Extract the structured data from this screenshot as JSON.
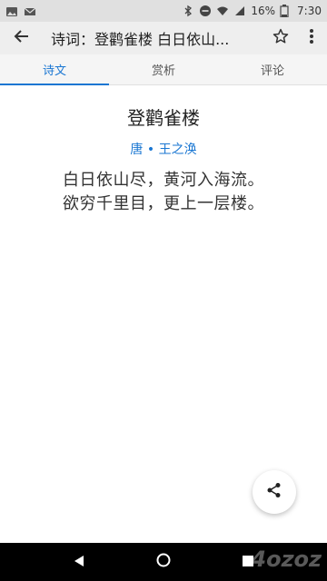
{
  "status_bar": {
    "battery_text": "16%",
    "time": "7:30",
    "icons": [
      "image-icon",
      "gmail-icon",
      "bluetooth-icon",
      "dnd-icon",
      "wifi-icon",
      "signal-icon",
      "battery-icon"
    ]
  },
  "app_bar": {
    "title": "诗词：登鹳雀楼 白日依山...",
    "icons": [
      "back-arrow-icon",
      "star-outline-icon",
      "more-vert-icon"
    ]
  },
  "tabs": [
    {
      "label": "诗文",
      "active": true
    },
    {
      "label": "赏析",
      "active": false
    },
    {
      "label": "评论",
      "active": false
    }
  ],
  "poem": {
    "title": "登鹳雀楼",
    "meta": "唐 • 王之涣",
    "lines": [
      "白日依山尽，黄河入海流。",
      "欲穷千里目，更上一层楼。"
    ]
  },
  "fab": {
    "icon": "share-icon"
  },
  "nav_bar": {
    "icons": [
      "back-triangle-icon",
      "home-circle-icon",
      "recents-square-icon"
    ]
  },
  "watermark": {
    "text": "4ozoz"
  },
  "colors": {
    "accent": "#1976d2",
    "app_bar_bg": "#eeeeee",
    "status_bar_bg": "#e0e0e0",
    "nav_bg": "#000000"
  }
}
